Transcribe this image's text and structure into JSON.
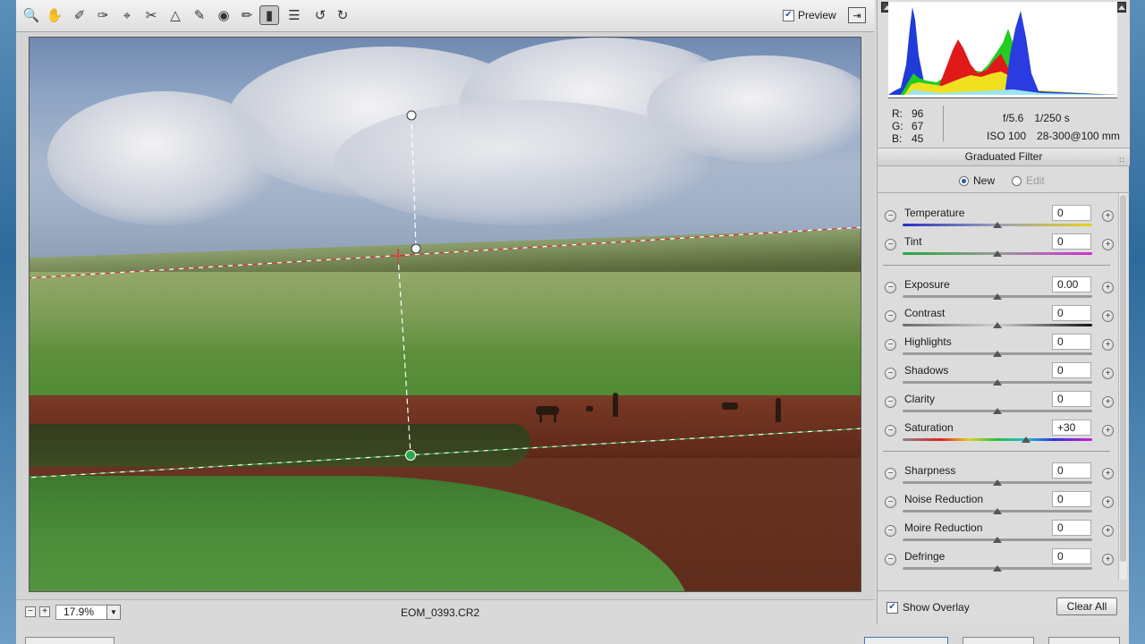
{
  "toolbar": {
    "tools": [
      "zoom-icon",
      "hand-icon",
      "white-balance-icon",
      "color-sampler-icon",
      "target-adjust-icon",
      "crop-icon",
      "straighten-icon",
      "spot-removal-icon",
      "red-eye-icon",
      "adjustment-brush-icon",
      "graduated-filter-icon",
      "presets-list-icon",
      "rotate-ccw-icon",
      "rotate-cw-icon"
    ],
    "preview_label": "Preview",
    "preview_checked": true
  },
  "histogram": {
    "r_label": "R:",
    "r_value": "96",
    "g_label": "G:",
    "g_value": "67",
    "b_label": "B:",
    "b_value": "45",
    "aperture": "f/5.6",
    "shutter": "1/250 s",
    "iso": "ISO 100",
    "lens": "28-300@100 mm"
  },
  "panel": {
    "title": "Graduated Filter",
    "mode_new": "New",
    "mode_edit": "Edit",
    "sliders": [
      {
        "label": "Temperature",
        "value": "0",
        "pos": 0.5
      },
      {
        "label": "Tint",
        "value": "0",
        "pos": 0.5
      },
      {
        "label": "Exposure",
        "value": "0.00",
        "pos": 0.5
      },
      {
        "label": "Contrast",
        "value": "0",
        "pos": 0.5
      },
      {
        "label": "Highlights",
        "value": "0",
        "pos": 0.5
      },
      {
        "label": "Shadows",
        "value": "0",
        "pos": 0.5
      },
      {
        "label": "Clarity",
        "value": "0",
        "pos": 0.5
      },
      {
        "label": "Saturation",
        "value": "+30",
        "pos": 0.65
      },
      {
        "label": "Sharpness",
        "value": "0",
        "pos": 0.5
      },
      {
        "label": "Noise Reduction",
        "value": "0",
        "pos": 0.5
      },
      {
        "label": "Moire Reduction",
        "value": "0",
        "pos": 0.5
      },
      {
        "label": "Defringe",
        "value": "0",
        "pos": 0.5
      }
    ],
    "show_overlay_label": "Show Overlay",
    "show_overlay_checked": true,
    "clear_all_label": "Clear All"
  },
  "status": {
    "zoom": "17.9%",
    "filename": "EOM_0393.CR2"
  },
  "colors": {
    "accent": "#2a55a5",
    "guide_red": "#d23a3a",
    "guide_green": "#2fa84a"
  }
}
